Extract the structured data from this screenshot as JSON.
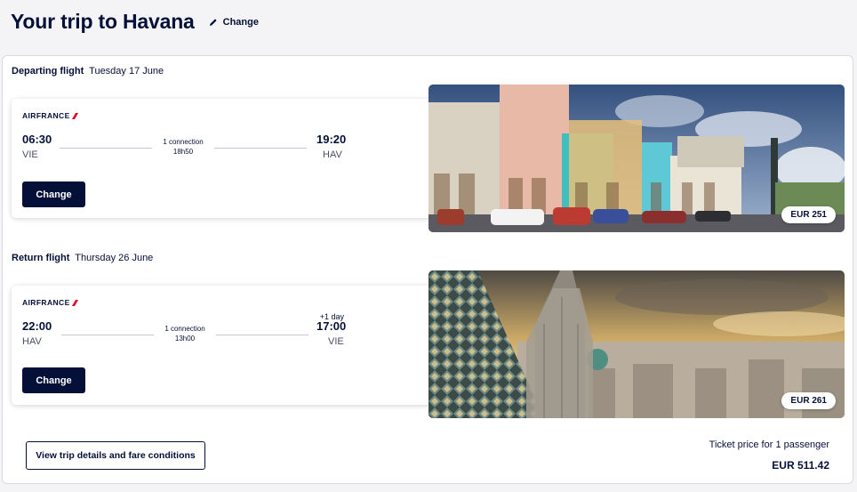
{
  "header": {
    "title": "Your trip to Havana",
    "change_label": "Change"
  },
  "departing": {
    "label": "Departing flight",
    "date": "Tuesday 17 June",
    "airline": "AIRFRANCE",
    "depart_time": "06:30",
    "depart_airport": "VIE",
    "connections": "1 connection",
    "duration": "18h50",
    "arrive_time": "19:20",
    "arrive_airport": "HAV",
    "next_day": "",
    "change_label": "Change",
    "price": "EUR 251",
    "photo_icon": "havana-street-photo"
  },
  "return": {
    "label": "Return flight",
    "date": "Thursday 26 June",
    "airline": "AIRFRANCE",
    "depart_time": "22:00",
    "depart_airport": "HAV",
    "connections": "1 connection",
    "duration": "13h00",
    "arrive_time": "17:00",
    "arrive_airport": "VIE",
    "next_day": "+1 day",
    "change_label": "Change",
    "price": "EUR 261",
    "photo_icon": "vienna-cathedral-photo"
  },
  "footer": {
    "details_label": "View trip details and fare conditions",
    "ticket_price_label": "Ticket price for 1 passenger",
    "total_price": "EUR 511.42"
  },
  "colors": {
    "brand_navy": "#051039",
    "airline_red": "#e3001b",
    "background": "#f4f4f6"
  }
}
